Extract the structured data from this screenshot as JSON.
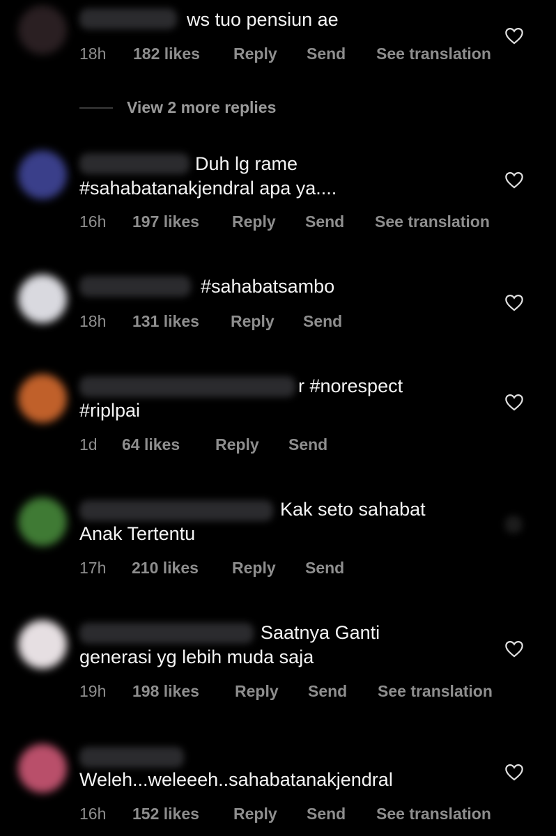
{
  "comments": [
    {
      "lines": [
        "ws tuo pensiun ae"
      ],
      "time": "18h",
      "likes": "182 likes",
      "reply": "Reply",
      "send": "Send",
      "translation": "See translation",
      "avatar_color": "#2a1f22"
    },
    {
      "lines": [
        "Duh lg rame",
        "#sahabatanakjendral apa ya...."
      ],
      "time": "16h",
      "likes": "197 likes",
      "reply": "Reply",
      "send": "Send",
      "translation": "See translation",
      "avatar_color": "#3a3f8a"
    },
    {
      "lines": [
        "#sahabatsambo"
      ],
      "time": "18h",
      "likes": "131 likes",
      "reply": "Reply",
      "send": "Send",
      "avatar_color": "#d9d9df"
    },
    {
      "lines": [
        "r #norespect",
        "#riplpai"
      ],
      "time": "1d",
      "likes": "64 likes",
      "reply": "Reply",
      "send": "Send",
      "avatar_color": "#c0602a"
    },
    {
      "lines": [
        "Kak seto sahabat",
        "Anak Tertentu"
      ],
      "time": "17h",
      "likes": "210 likes",
      "reply": "Reply",
      "send": "Send",
      "avatar_color": "#3f7a34"
    },
    {
      "lines": [
        "Saatnya Ganti",
        "generasi yg lebih muda saja"
      ],
      "time": "19h",
      "likes": "198 likes",
      "reply": "Reply",
      "send": "Send",
      "translation": "See translation",
      "avatar_color": "#e6dfe2"
    },
    {
      "lines": [
        "Weleh...weleeeh..sahabatanakjendral"
      ],
      "time": "16h",
      "likes": "152 likes",
      "reply": "Reply",
      "send": "Send",
      "translation": "See translation",
      "avatar_color": "#b94f6a"
    }
  ],
  "view_replies": "View 2 more replies",
  "icons": {
    "like": "heart-outline-icon"
  }
}
